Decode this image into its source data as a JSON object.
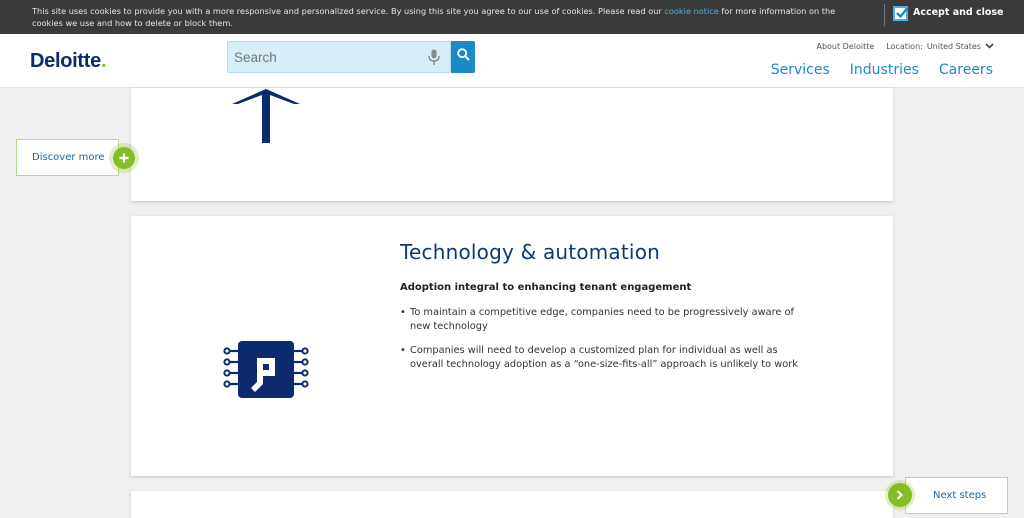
{
  "cookie_bar": {
    "text_before": "This site uses cookies to provide you with a more responsive and personalized service. By using this site you agree to our use of cookies. Please read our ",
    "link": "cookie notice",
    "text_after": " for more information on the cookies we use and how to delete or block them.",
    "accept_label": "Accept and close",
    "accent": "#4eb0e6"
  },
  "header": {
    "logo": "Deloitte",
    "logo_dot": ".",
    "search_placeholder": "Search",
    "about": "About Deloitte",
    "location_label": "Location:",
    "location_value": "United States",
    "nav": [
      "Services",
      "Industries",
      "Careers"
    ],
    "brand_color": "#0d2a6e",
    "accent_color": "#86bc25",
    "link_color": "#1a8ac9"
  },
  "section": {
    "title": "Technology & automation",
    "subtitle": "Adoption integral to enhancing tenant engagement",
    "bullets": [
      "To maintain a competitive edge, companies need to be progressively aware of new technology",
      "Companies will need to develop a customized plan for individual as well as overall technology adoption as a “one-size-fits-all” approach is unlikely to work"
    ],
    "icon": "chip-icon"
  },
  "floating": {
    "discover_label": "Discover more",
    "next_label": "Next steps"
  }
}
